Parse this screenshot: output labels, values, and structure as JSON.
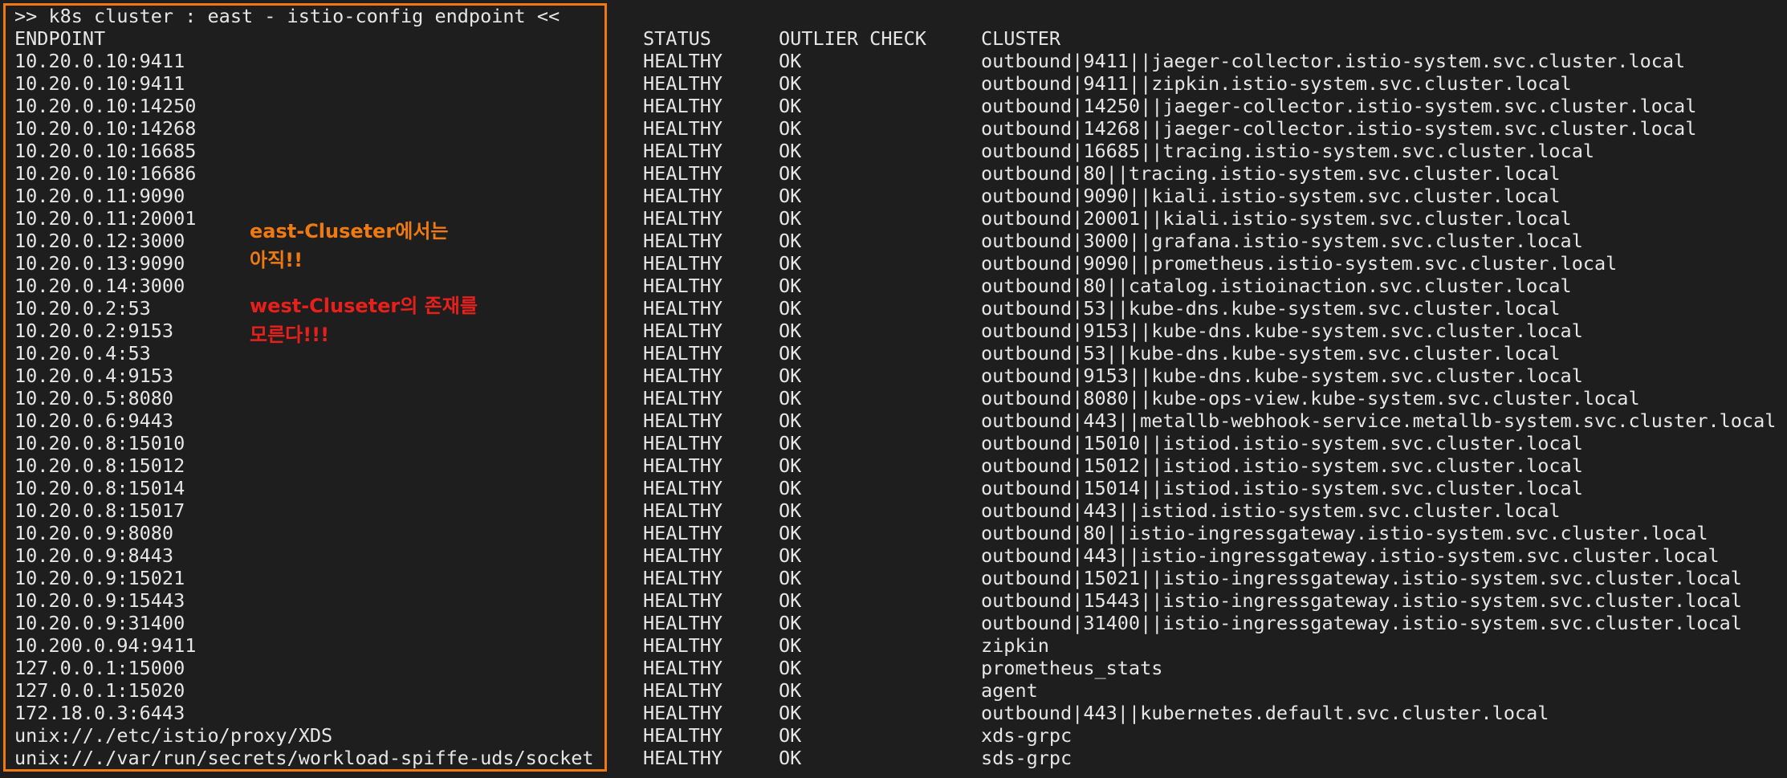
{
  "terminal": {
    "header": ">> k8s cluster : east - istio-config endpoint <<",
    "columns": {
      "endpoint": "ENDPOINT",
      "status": "STATUS",
      "outlier": "OUTLIER CHECK",
      "cluster": "CLUSTER"
    },
    "rows": [
      {
        "endpoint": "10.20.0.10:9411",
        "status": "HEALTHY",
        "outlier": "OK",
        "cluster": "outbound|9411||jaeger-collector.istio-system.svc.cluster.local"
      },
      {
        "endpoint": "10.20.0.10:9411",
        "status": "HEALTHY",
        "outlier": "OK",
        "cluster": "outbound|9411||zipkin.istio-system.svc.cluster.local"
      },
      {
        "endpoint": "10.20.0.10:14250",
        "status": "HEALTHY",
        "outlier": "OK",
        "cluster": "outbound|14250||jaeger-collector.istio-system.svc.cluster.local"
      },
      {
        "endpoint": "10.20.0.10:14268",
        "status": "HEALTHY",
        "outlier": "OK",
        "cluster": "outbound|14268||jaeger-collector.istio-system.svc.cluster.local"
      },
      {
        "endpoint": "10.20.0.10:16685",
        "status": "HEALTHY",
        "outlier": "OK",
        "cluster": "outbound|16685||tracing.istio-system.svc.cluster.local"
      },
      {
        "endpoint": "10.20.0.10:16686",
        "status": "HEALTHY",
        "outlier": "OK",
        "cluster": "outbound|80||tracing.istio-system.svc.cluster.local"
      },
      {
        "endpoint": "10.20.0.11:9090",
        "status": "HEALTHY",
        "outlier": "OK",
        "cluster": "outbound|9090||kiali.istio-system.svc.cluster.local"
      },
      {
        "endpoint": "10.20.0.11:20001",
        "status": "HEALTHY",
        "outlier": "OK",
        "cluster": "outbound|20001||kiali.istio-system.svc.cluster.local"
      },
      {
        "endpoint": "10.20.0.12:3000",
        "status": "HEALTHY",
        "outlier": "OK",
        "cluster": "outbound|3000||grafana.istio-system.svc.cluster.local"
      },
      {
        "endpoint": "10.20.0.13:9090",
        "status": "HEALTHY",
        "outlier": "OK",
        "cluster": "outbound|9090||prometheus.istio-system.svc.cluster.local"
      },
      {
        "endpoint": "10.20.0.14:3000",
        "status": "HEALTHY",
        "outlier": "OK",
        "cluster": "outbound|80||catalog.istioinaction.svc.cluster.local"
      },
      {
        "endpoint": "10.20.0.2:53",
        "status": "HEALTHY",
        "outlier": "OK",
        "cluster": "outbound|53||kube-dns.kube-system.svc.cluster.local"
      },
      {
        "endpoint": "10.20.0.2:9153",
        "status": "HEALTHY",
        "outlier": "OK",
        "cluster": "outbound|9153||kube-dns.kube-system.svc.cluster.local"
      },
      {
        "endpoint": "10.20.0.4:53",
        "status": "HEALTHY",
        "outlier": "OK",
        "cluster": "outbound|53||kube-dns.kube-system.svc.cluster.local"
      },
      {
        "endpoint": "10.20.0.4:9153",
        "status": "HEALTHY",
        "outlier": "OK",
        "cluster": "outbound|9153||kube-dns.kube-system.svc.cluster.local"
      },
      {
        "endpoint": "10.20.0.5:8080",
        "status": "HEALTHY",
        "outlier": "OK",
        "cluster": "outbound|8080||kube-ops-view.kube-system.svc.cluster.local"
      },
      {
        "endpoint": "10.20.0.6:9443",
        "status": "HEALTHY",
        "outlier": "OK",
        "cluster": "outbound|443||metallb-webhook-service.metallb-system.svc.cluster.local"
      },
      {
        "endpoint": "10.20.0.8:15010",
        "status": "HEALTHY",
        "outlier": "OK",
        "cluster": "outbound|15010||istiod.istio-system.svc.cluster.local"
      },
      {
        "endpoint": "10.20.0.8:15012",
        "status": "HEALTHY",
        "outlier": "OK",
        "cluster": "outbound|15012||istiod.istio-system.svc.cluster.local"
      },
      {
        "endpoint": "10.20.0.8:15014",
        "status": "HEALTHY",
        "outlier": "OK",
        "cluster": "outbound|15014||istiod.istio-system.svc.cluster.local"
      },
      {
        "endpoint": "10.20.0.8:15017",
        "status": "HEALTHY",
        "outlier": "OK",
        "cluster": "outbound|443||istiod.istio-system.svc.cluster.local"
      },
      {
        "endpoint": "10.20.0.9:8080",
        "status": "HEALTHY",
        "outlier": "OK",
        "cluster": "outbound|80||istio-ingressgateway.istio-system.svc.cluster.local"
      },
      {
        "endpoint": "10.20.0.9:8443",
        "status": "HEALTHY",
        "outlier": "OK",
        "cluster": "outbound|443||istio-ingressgateway.istio-system.svc.cluster.local"
      },
      {
        "endpoint": "10.20.0.9:15021",
        "status": "HEALTHY",
        "outlier": "OK",
        "cluster": "outbound|15021||istio-ingressgateway.istio-system.svc.cluster.local"
      },
      {
        "endpoint": "10.20.0.9:15443",
        "status": "HEALTHY",
        "outlier": "OK",
        "cluster": "outbound|15443||istio-ingressgateway.istio-system.svc.cluster.local"
      },
      {
        "endpoint": "10.20.0.9:31400",
        "status": "HEALTHY",
        "outlier": "OK",
        "cluster": "outbound|31400||istio-ingressgateway.istio-system.svc.cluster.local"
      },
      {
        "endpoint": "10.200.0.94:9411",
        "status": "HEALTHY",
        "outlier": "OK",
        "cluster": "zipkin"
      },
      {
        "endpoint": "127.0.0.1:15000",
        "status": "HEALTHY",
        "outlier": "OK",
        "cluster": "prometheus_stats"
      },
      {
        "endpoint": "127.0.0.1:15020",
        "status": "HEALTHY",
        "outlier": "OK",
        "cluster": "agent"
      },
      {
        "endpoint": "172.18.0.3:6443",
        "status": "HEALTHY",
        "outlier": "OK",
        "cluster": "outbound|443||kubernetes.default.svc.cluster.local"
      },
      {
        "endpoint": "unix://./etc/istio/proxy/XDS",
        "status": "HEALTHY",
        "outlier": "OK",
        "cluster": "xds-grpc"
      },
      {
        "endpoint": "unix://./var/run/secrets/workload-spiffe-uds/socket",
        "status": "HEALTHY",
        "outlier": "OK",
        "cluster": "sds-grpc"
      }
    ]
  },
  "annotations": {
    "note1": "east-Cluseter에서는\n아직!!",
    "note2": "west-Cluseter의 존재를\n모른다!!!"
  },
  "colors": {
    "background": "#1e1e1e",
    "text": "#e6e6e6",
    "highlight_box": "#f07a12",
    "note1": "#f07a12",
    "note2": "#e8201c"
  }
}
